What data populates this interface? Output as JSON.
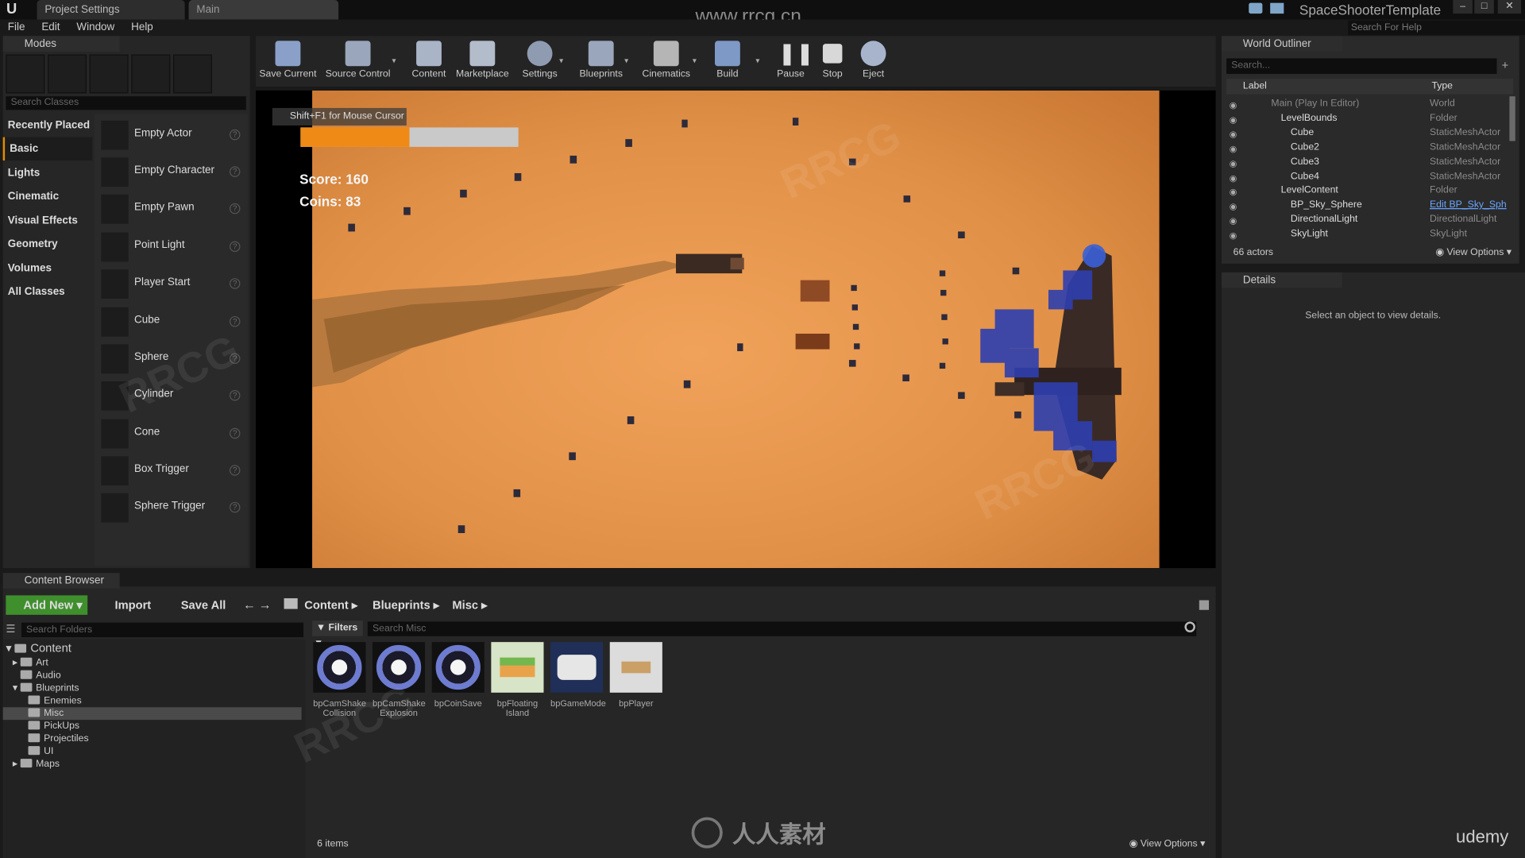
{
  "window": {
    "tabs": [
      "Project Settings",
      "Main"
    ],
    "app_name": "SpaceShooterTemplate",
    "search_help_placeholder": "Search For Help",
    "watermark_url": "www.rrcg.cn"
  },
  "menu": [
    "File",
    "Edit",
    "Window",
    "Help"
  ],
  "modes": {
    "title": "Modes",
    "search_placeholder": "Search Classes",
    "categories": [
      "Recently Placed",
      "Basic",
      "Lights",
      "Cinematic",
      "Visual Effects",
      "Geometry",
      "Volumes",
      "All Classes"
    ],
    "active_category": "Basic",
    "items": [
      "Empty Actor",
      "Empty Character",
      "Empty Pawn",
      "Point Light",
      "Player Start",
      "Cube",
      "Sphere",
      "Cylinder",
      "Cone",
      "Box Trigger",
      "Sphere Trigger"
    ]
  },
  "toolbar": [
    "Save Current",
    "Source Control",
    "Content",
    "Marketplace",
    "Settings",
    "Blueprints",
    "Cinematics",
    "Build",
    "Pause",
    "Stop",
    "Eject"
  ],
  "viewport": {
    "hint": "Shift+F1 for Mouse Cursor",
    "score": "Score: 160",
    "coins": "Coins: 83",
    "health_fraction": 0.5
  },
  "outliner": {
    "title": "World Outliner",
    "search_placeholder": "Search...",
    "col_label": "Label",
    "col_type": "Type",
    "rows": [
      {
        "name": "Main (Play In Editor)",
        "type": "World"
      },
      {
        "name": "LevelBounds",
        "type": "Folder"
      },
      {
        "name": "Cube",
        "type": "StaticMeshActor"
      },
      {
        "name": "Cube2",
        "type": "StaticMeshActor"
      },
      {
        "name": "Cube3",
        "type": "StaticMeshActor"
      },
      {
        "name": "Cube4",
        "type": "StaticMeshActor"
      },
      {
        "name": "LevelContent",
        "type": "Folder"
      },
      {
        "name": "BP_Sky_Sphere",
        "type": "Edit BP_Sky_Sph"
      },
      {
        "name": "DirectionalLight",
        "type": "DirectionalLight"
      },
      {
        "name": "SkyLight",
        "type": "SkyLight"
      }
    ],
    "actors_count": "66 actors",
    "view_options": "View Options"
  },
  "details": {
    "title": "Details",
    "empty_msg": "Select an object to view details."
  },
  "content_browser": {
    "title": "Content Browser",
    "add_new": "Add New",
    "import": "Import",
    "save_all": "Save All",
    "path": [
      "Content",
      "Blueprints",
      "Misc"
    ],
    "search_folders": "Search Folders",
    "filters": "Filters",
    "search_assets": "Search Misc",
    "tree": [
      "Content",
      "Art",
      "Audio",
      "Blueprints",
      "Enemies",
      "Misc",
      "PickUps",
      "Projectiles",
      "UI",
      "Maps"
    ],
    "assets": [
      "bpCamShake Collision",
      "bpCamShake Explosion",
      "bpCoinSave",
      "bpFloating Island",
      "bpGameMode",
      "bpPlayer"
    ],
    "items_count": "6 items",
    "view_options": "View Options"
  },
  "logos": {
    "site": "人人素材",
    "udemy": "udemy"
  },
  "colors": {
    "accent": "#e08e00",
    "health": "#ef8a17",
    "add_new": "#3f8f2d"
  }
}
